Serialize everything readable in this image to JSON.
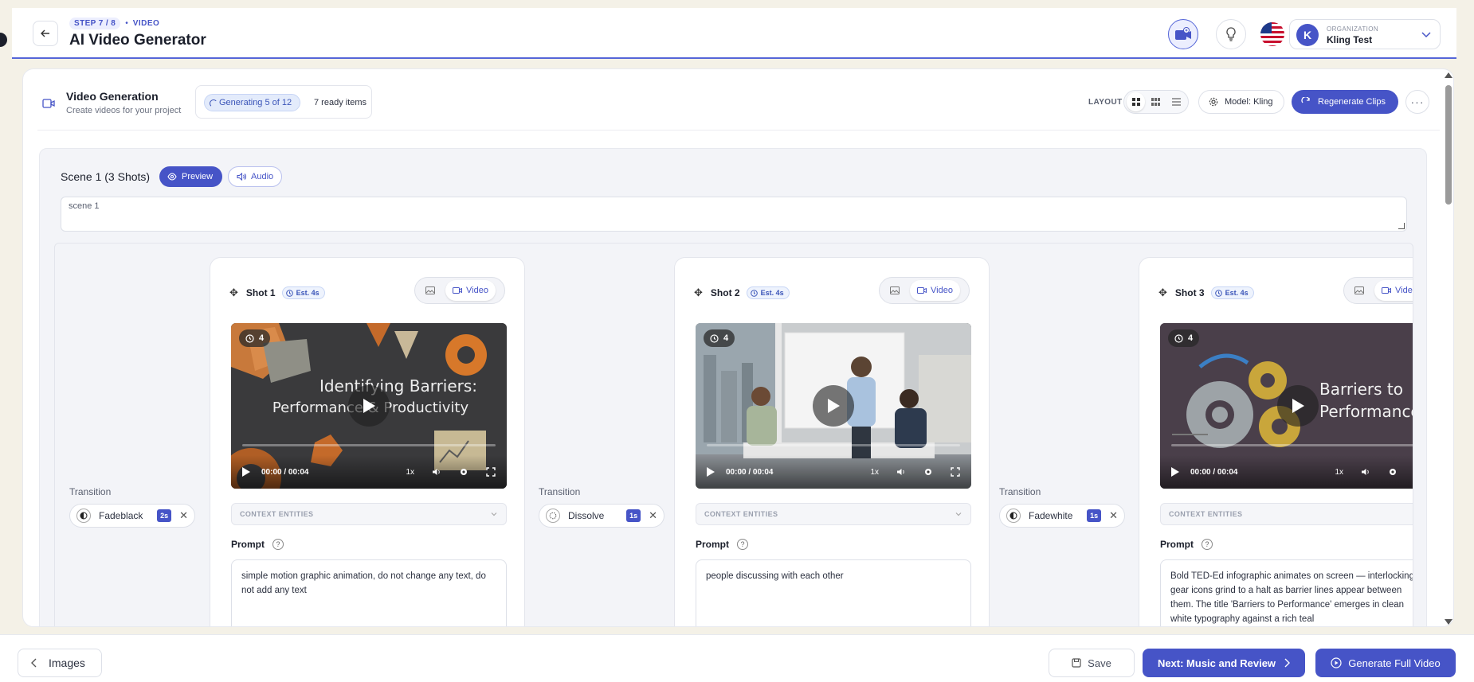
{
  "header": {
    "step": "STEP 7 / 8",
    "step_separator": "•",
    "step_type": "VIDEO",
    "title": "AI Video Generator",
    "organization_label": "ORGANIZATION",
    "organization_name": "Kling Test",
    "avatar_initial": "K"
  },
  "toolbar": {
    "title": "Video Generation",
    "subtitle": "Create videos for your project",
    "generating_label": "Generating 5 of 12",
    "ready_label": "7 ready items",
    "layout_label": "LAYOUT",
    "model_label": "Model: Kling",
    "regenerate_label": "Regenerate Clips",
    "more_label": "···"
  },
  "scene": {
    "title": "Scene 1 (3 Shots)",
    "preview_label": "Preview",
    "audio_label": "Audio",
    "description": "scene 1"
  },
  "transitions": [
    {
      "label": "Transition",
      "name": "Fadeblack",
      "duration": "2s",
      "close": "✕"
    },
    {
      "label": "Transition",
      "name": "Dissolve",
      "duration": "1s",
      "close": "✕"
    },
    {
      "label": "Transition",
      "name": "Fadewhite",
      "duration": "1s",
      "close": "✕"
    }
  ],
  "shots": [
    {
      "name": "Shot 1",
      "estimate": "Est. 4s",
      "media_video_label": "Video",
      "duration_badge": "4",
      "video_text_line1": "Identifying Barriers:",
      "video_text_line2": "Performance & Productivity",
      "time": "00:00 / 00:04",
      "speed": "1x",
      "context_label": "CONTEXT ENTITIES",
      "prompt_label": "Prompt",
      "prompt": "simple motion graphic animation, do not change any text, do not add any text"
    },
    {
      "name": "Shot 2",
      "estimate": "Est. 4s",
      "media_video_label": "Video",
      "duration_badge": "4",
      "time": "00:00 / 00:04",
      "speed": "1x",
      "context_label": "CONTEXT ENTITIES",
      "prompt_label": "Prompt",
      "prompt": "people discussing with each other"
    },
    {
      "name": "Shot 3",
      "estimate": "Est. 4s",
      "media_video_label": "Video",
      "duration_badge": "4",
      "video_text_line1": "Barriers to",
      "video_text_line2": "Performance",
      "time": "00:00 / 00:04",
      "speed": "1x",
      "context_label": "CONTEXT ENTITIES",
      "prompt_label": "Prompt",
      "prompt": "Bold TED-Ed infographic animates on screen — interlocking gear icons grind to a halt as barrier lines appear between them. The title 'Barriers to Performance' emerges in clean white typography against a rich teal"
    }
  ],
  "footer": {
    "images_label": "Images",
    "save_label": "Save",
    "next_label": "Next: Music and Review",
    "generate_label": "Generate Full Video"
  },
  "colors": {
    "accent": "#4654c7",
    "background": "#f4f1e7",
    "panel": "#ffffff"
  }
}
